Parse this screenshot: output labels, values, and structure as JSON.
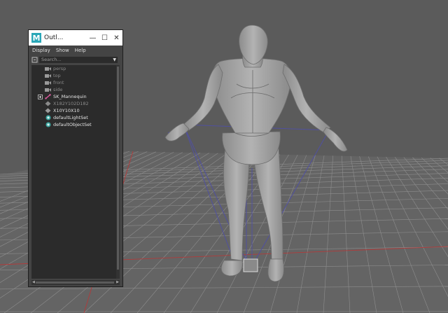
{
  "outliner": {
    "title": "Outl...",
    "app_logo": "M",
    "menu": [
      "Display",
      "Show",
      "Help"
    ],
    "search_placeholder": "Search...",
    "items": [
      {
        "label": "persp",
        "icon": "camera-icon",
        "dim": true
      },
      {
        "label": "top",
        "icon": "camera-icon",
        "dim": true
      },
      {
        "label": "front",
        "icon": "camera-icon",
        "dim": true
      },
      {
        "label": "side",
        "icon": "camera-icon",
        "dim": true
      },
      {
        "label": "SK_Mannequin",
        "icon": "skeleton-icon",
        "dim": false
      },
      {
        "label": "X182Y102D182",
        "icon": "locator-icon",
        "dim": true
      },
      {
        "label": "X10Y10X10",
        "icon": "locator-icon",
        "dim": false
      },
      {
        "label": "defaultLightSet",
        "icon": "set-icon",
        "dim": false
      },
      {
        "label": "defaultObjectSet",
        "icon": "set-icon",
        "dim": false
      }
    ]
  },
  "colors": {
    "viewport_bg": "#5a5a5a",
    "grid": "#8c8c8c",
    "grid_axis": "#b03030",
    "model": "#a8a8a8",
    "rig_lines": "#4a4a9a"
  }
}
